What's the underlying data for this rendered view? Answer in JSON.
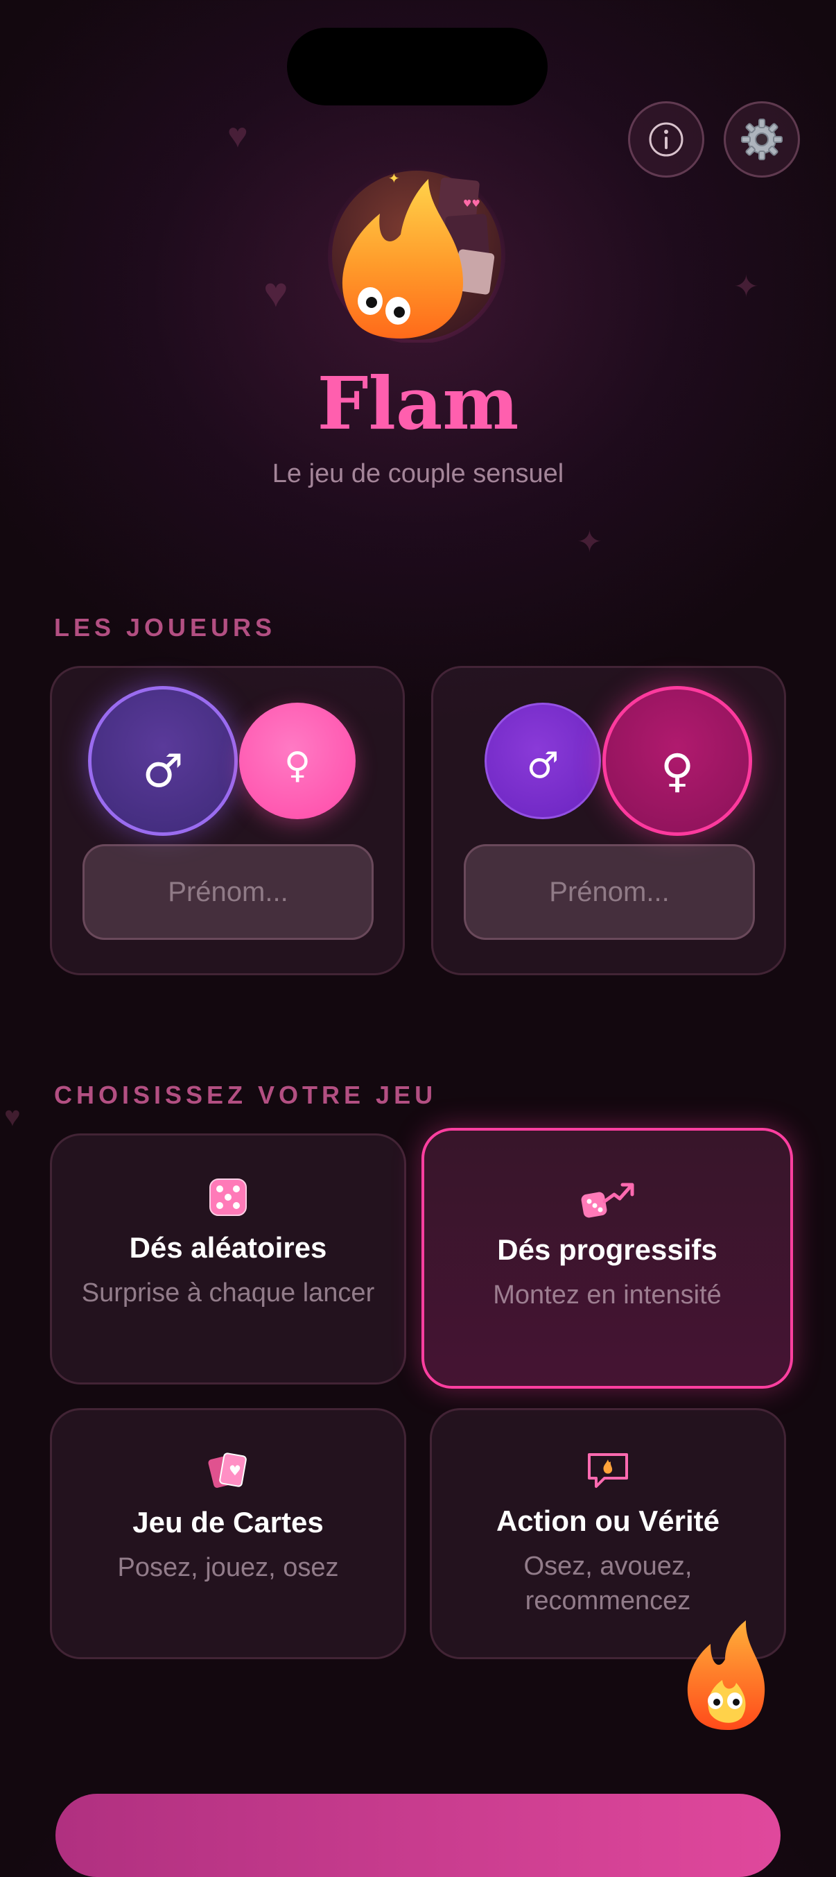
{
  "app": {
    "title": "Flam",
    "subtitle": "Le jeu de couple sensuel"
  },
  "toolbar": {
    "info_icon": "info-icon",
    "settings_icon": "gear-icon"
  },
  "players": {
    "label": "LES JOUEURS",
    "items": [
      {
        "male_symbol": "♂",
        "female_symbol": "♀",
        "selected": "male",
        "name_placeholder": "Prénom..."
      },
      {
        "male_symbol": "♂",
        "female_symbol": "♀",
        "selected": "female",
        "name_placeholder": "Prénom..."
      }
    ]
  },
  "games": {
    "label": "CHOISISSEZ VOTRE JEU",
    "items": [
      {
        "title": "Dés aléatoires",
        "subtitle": "Surprise à chaque lancer",
        "icon": "dice-icon",
        "selected": false
      },
      {
        "title": "Dés progressifs",
        "subtitle": "Montez en intensité",
        "icon": "dice-trend-icon",
        "selected": true
      },
      {
        "title": "Jeu de Cartes",
        "subtitle": "Posez, jouez, osez",
        "icon": "cards-icon",
        "selected": false
      },
      {
        "title": "Action ou Vérité",
        "subtitle": "Osez, avouez, recommencez",
        "icon": "chat-flame-icon",
        "selected": false
      }
    ]
  },
  "colors": {
    "accent": "#ff4fa8",
    "male": "#7b4dd8",
    "female": "#ff4fa8",
    "background": "#1a0a17"
  }
}
